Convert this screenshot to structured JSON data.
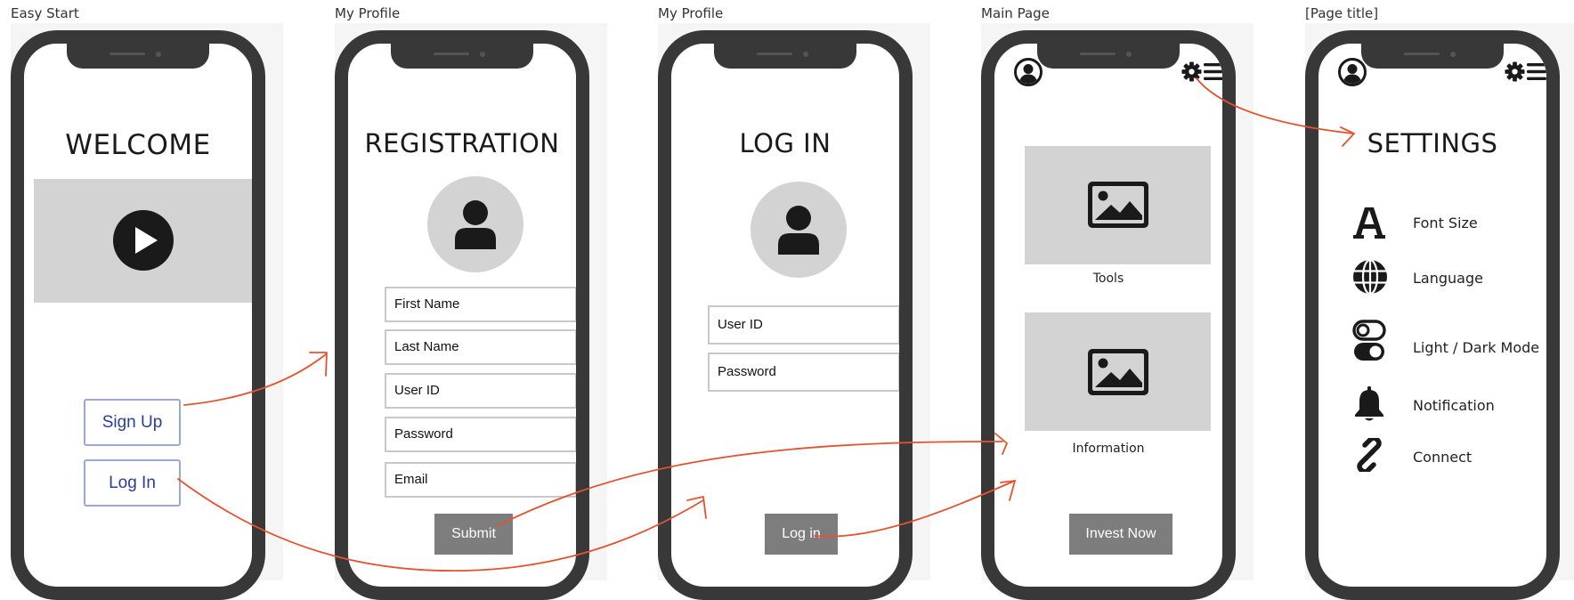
{
  "frames": {
    "easy_start": {
      "label": "Easy Start",
      "title": "WELCOME",
      "signup_label": "Sign Up",
      "login_label": "Log In"
    },
    "registration": {
      "label": "My Profile",
      "title": "REGISTRATION",
      "fields": {
        "first_name": "First Name",
        "last_name": "Last Name",
        "user_id": "User ID",
        "password": "Password",
        "email": "Email"
      },
      "submit_label": "Submit"
    },
    "login": {
      "label": "My Profile",
      "title": "LOG IN",
      "fields": {
        "user_id": "User ID",
        "password": "Password"
      },
      "login_button_label": "Log in"
    },
    "main_page": {
      "label": "Main Page",
      "tools_caption": "Tools",
      "information_caption": "Information",
      "invest_label": "Invest Now"
    },
    "settings": {
      "label": "[Page title]",
      "title": "SETTINGS",
      "items": [
        {
          "label": "Font Size",
          "icon": "font-size-icon"
        },
        {
          "label": "Language",
          "icon": "globe-icon"
        },
        {
          "label": "Light / Dark Mode",
          "icon": "toggle-icon"
        },
        {
          "label": "Notification",
          "icon": "bell-icon"
        },
        {
          "label": "Connect",
          "icon": "link-icon"
        }
      ]
    }
  },
  "colors": {
    "arrow": "#e5532e",
    "phone_frame": "#383838",
    "placeholder_gray": "#d3d3d3",
    "button_gray": "#7d7d7d",
    "outline_button_text": "#2a3d9c",
    "outline_button_border": "#9aa7d8"
  }
}
